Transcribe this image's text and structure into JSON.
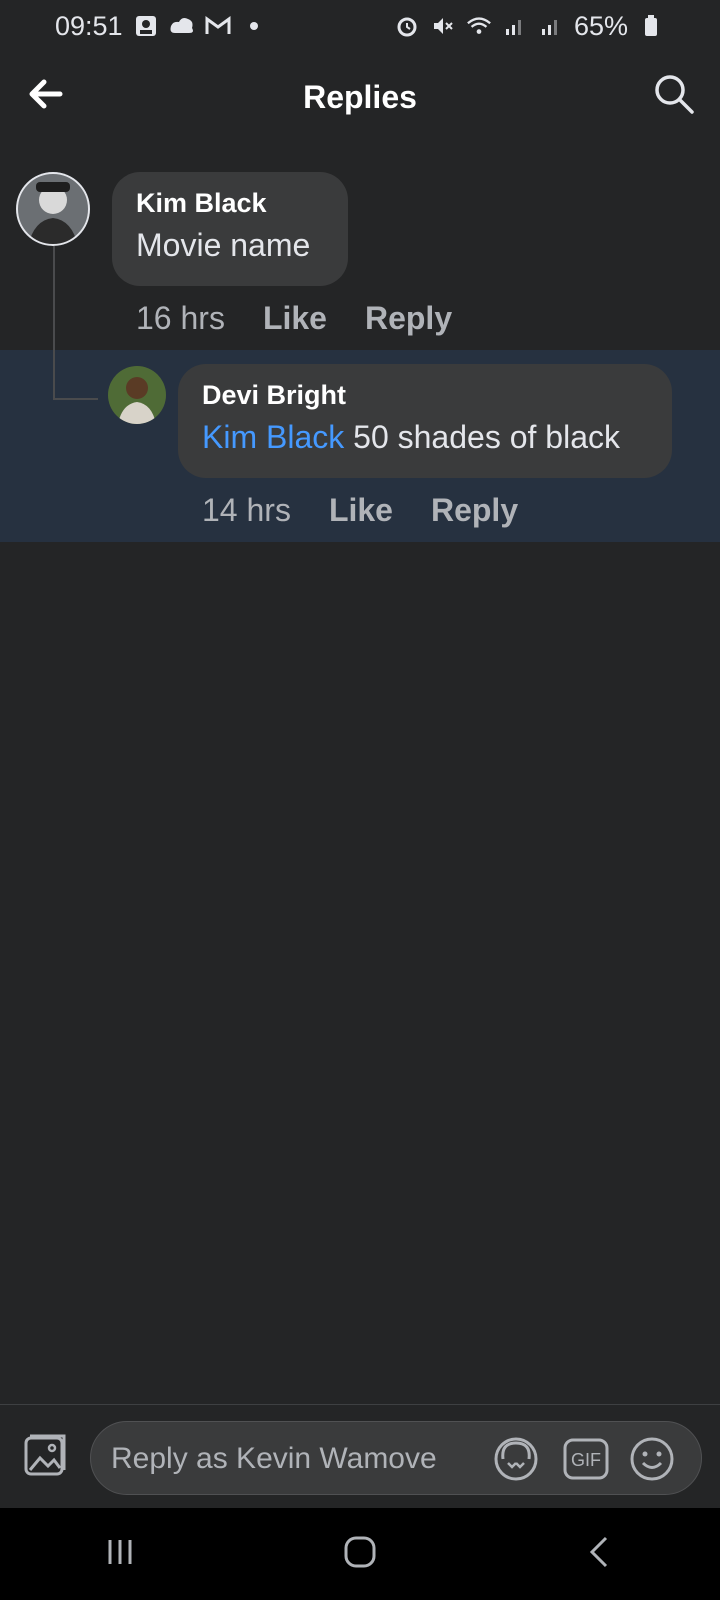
{
  "status_bar": {
    "time": "09:51",
    "battery_percent": "65%"
  },
  "header": {
    "title": "Replies"
  },
  "comments": [
    {
      "author": "Kim Black",
      "text": "Movie name",
      "time": "16 hrs",
      "like_label": "Like",
      "reply_label": "Reply"
    },
    {
      "author": "Devi Bright",
      "mention": "Kim Black",
      "text": "50 shades of black",
      "time": "14 hrs",
      "like_label": "Like",
      "reply_label": "Reply"
    }
  ],
  "composer": {
    "placeholder": "Reply as Kevin Wamove"
  },
  "icons": {
    "back": "back-arrow-icon",
    "search": "search-icon",
    "photo": "photo-icon",
    "avatar_sticker": "avatar-sticker-icon",
    "gif": "gif-icon",
    "emoji": "emoji-icon"
  },
  "colors": {
    "background": "#242526",
    "bubble": "#3a3b3c",
    "highlight": "#263140",
    "mention": "#4599ff"
  }
}
